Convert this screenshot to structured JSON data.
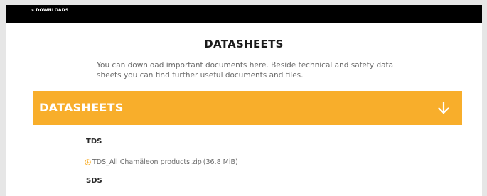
{
  "breadcrumb": {
    "label": "» DOWNLOADS"
  },
  "page": {
    "title": "DATASHEETS",
    "intro": "You can download important documents here. Beside technical and safety data sheets you can find further useful documents and files."
  },
  "accordion": {
    "title": "DATASHEETS",
    "toggle_icon": "arrow-down-icon"
  },
  "sections": [
    {
      "label": "TDS",
      "files": [
        {
          "icon": "download-icon",
          "name": "TDS_All Chamäleon products.zip",
          "size": "(36.8 MiB)"
        }
      ]
    },
    {
      "label": "SDS",
      "files": []
    }
  ],
  "colors": {
    "topbar": "#000000",
    "accent": "#f8ae2b",
    "text": "#6b6b6b",
    "heading": "#1b1b1b"
  }
}
